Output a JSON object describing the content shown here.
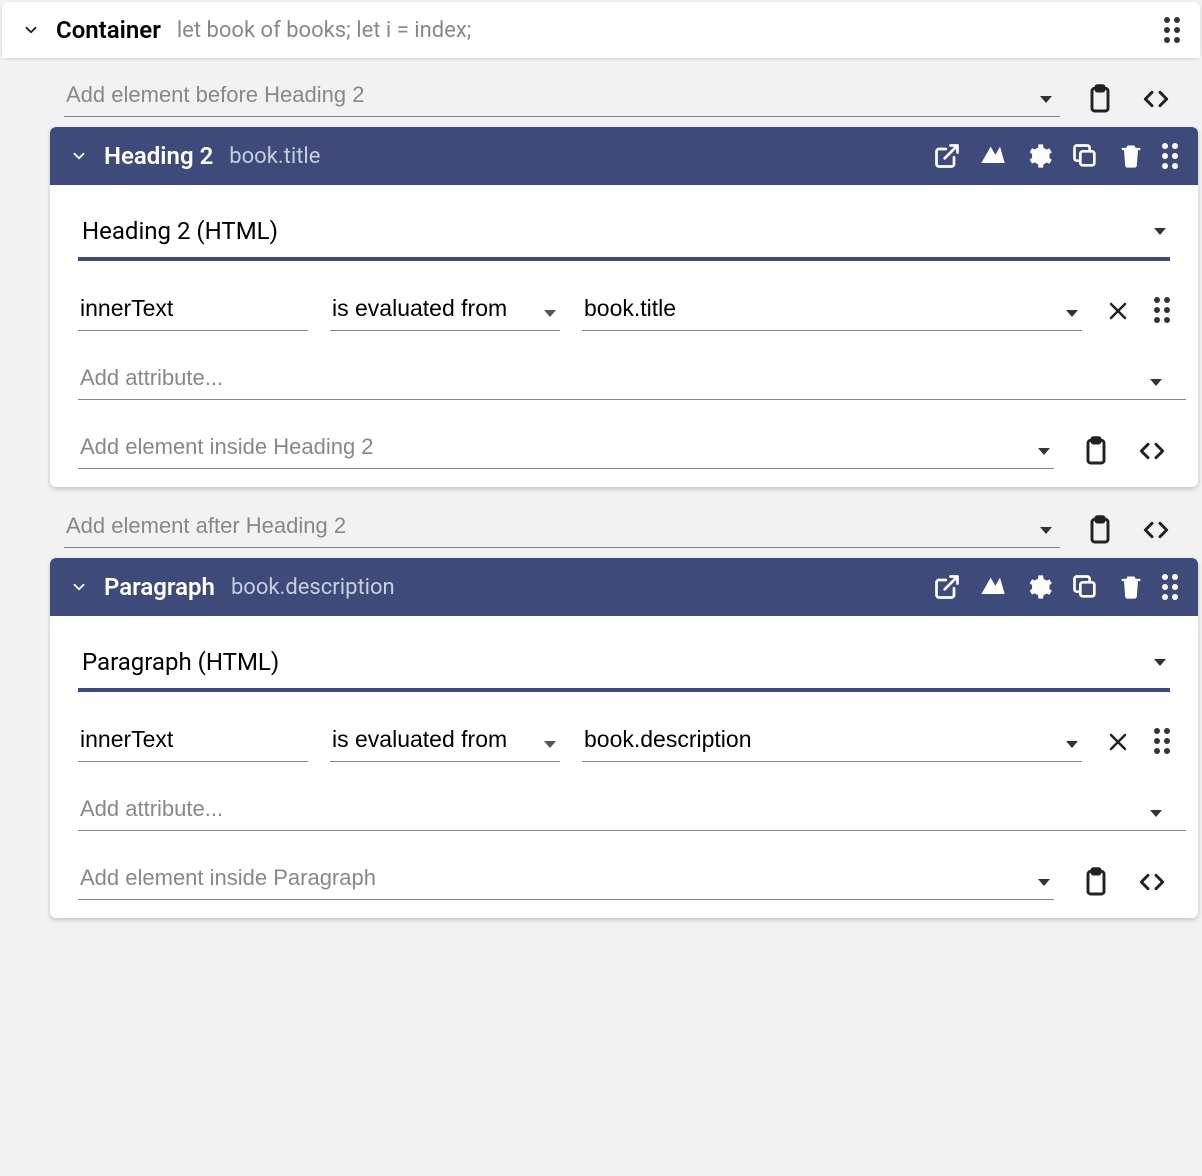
{
  "container": {
    "title": "Container",
    "expression": "let book of books; let i = index;"
  },
  "insert_before": {
    "placeholder": "Add element before Heading 2"
  },
  "insert_after": {
    "placeholder": "Add element after Heading 2"
  },
  "heading2": {
    "title": "Heading 2",
    "binding": "book.title",
    "type_label": "Heading 2 (HTML)",
    "attr": {
      "name": "innerText",
      "op": "is evaluated from",
      "value": "book.title"
    },
    "add_attr_placeholder": "Add attribute...",
    "add_inside_placeholder": "Add element inside Heading 2"
  },
  "paragraph": {
    "title": "Paragraph",
    "binding": "book.description",
    "type_label": "Paragraph (HTML)",
    "attr": {
      "name": "innerText",
      "op": "is evaluated from",
      "value": "book.description"
    },
    "add_attr_placeholder": "Add attribute...",
    "add_inside_placeholder": "Add element inside Paragraph"
  }
}
